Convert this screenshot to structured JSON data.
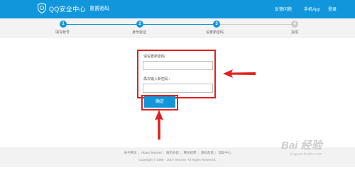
{
  "header": {
    "brand": "QQ安全中心",
    "subtitle": "重置密码",
    "nav": [
      "反馈问题",
      "手机App",
      "登录"
    ]
  },
  "progress": {
    "steps": [
      {
        "num": "1",
        "label": "填写帐号",
        "state": "done"
      },
      {
        "num": "2",
        "label": "身份验证",
        "state": "done"
      },
      {
        "num": "3",
        "label": "设置新密码",
        "state": "current"
      },
      {
        "num": "4",
        "label": "完成",
        "state": "todo"
      }
    ]
  },
  "form": {
    "new_password_label": "请设置新密码：",
    "new_password_value": "",
    "confirm_password_label": "再次输入新密码：",
    "confirm_password_value": "",
    "confirm_button": "确定"
  },
  "footer": {
    "links": [
      "关于腾讯",
      "About Tencent",
      "服务条款",
      "腾讯招聘",
      "隐私政策",
      "帮助中心"
    ],
    "copyright": "Copyright © 1998 - 2019 Tencent. All Rights Reserved."
  },
  "watermark": {
    "text": "Bai 经验",
    "url": "jingyan.baidu.com"
  },
  "colors": {
    "brand_blue": "#1296db",
    "highlight_red": "#e02020",
    "step_inactive": "#cccccc"
  }
}
